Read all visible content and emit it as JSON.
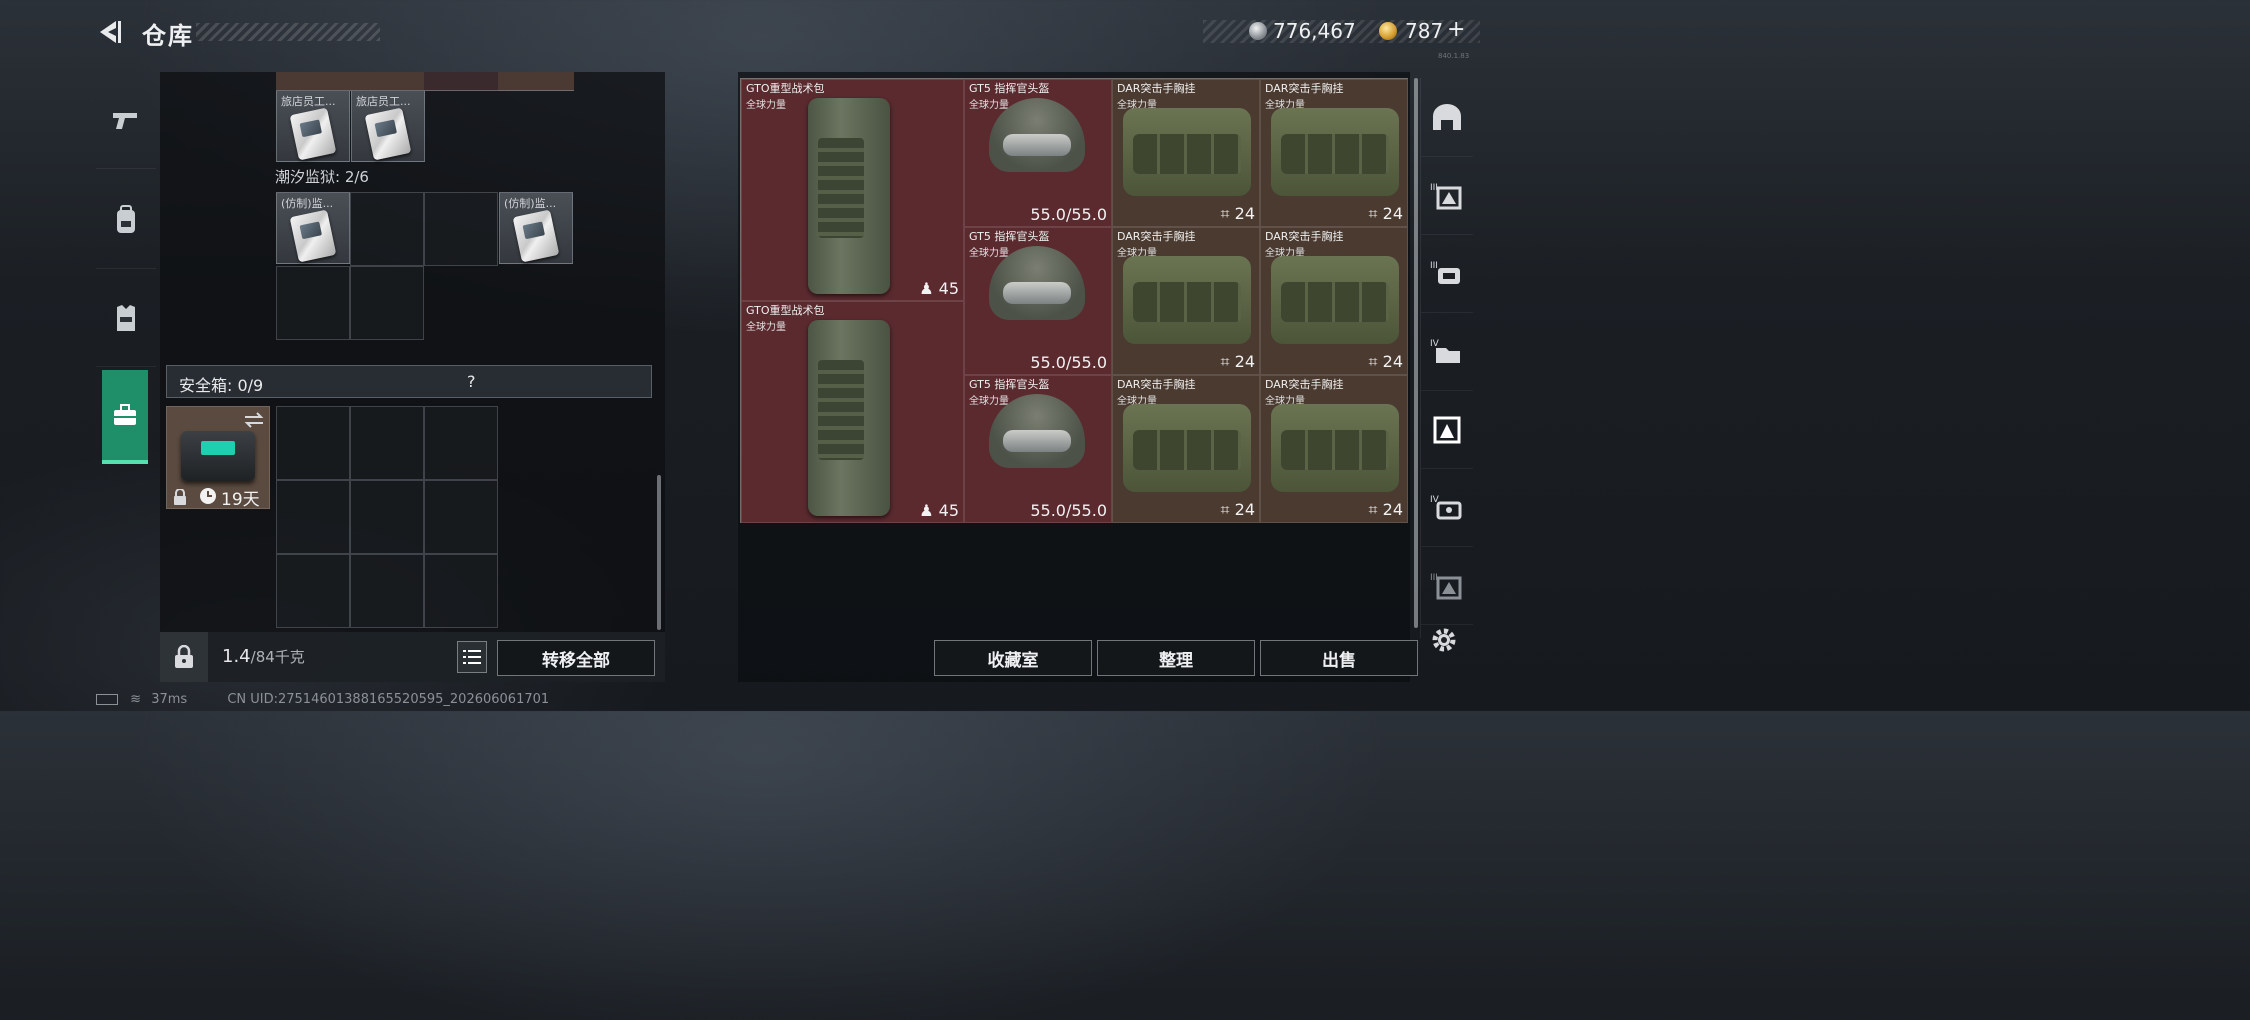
{
  "header": {
    "title": "仓库",
    "currency_silver": "776,467",
    "currency_gold": "787",
    "gold_plus": "+",
    "version": "840.1.83"
  },
  "left_nav": {
    "tabs": [
      "weapons-tab",
      "backpack-tab",
      "vest-tab",
      "safe-tab"
    ],
    "active": "safe-tab"
  },
  "inventory": {
    "top_items": [
      {
        "label": "旅店员工..."
      },
      {
        "label": "旅店员工..."
      }
    ],
    "section_label": "潮汐监狱: 2/6",
    "prison_items": [
      {
        "label": "(仿制)监..."
      },
      {
        "label": "(仿制)监..."
      }
    ],
    "safe": {
      "label": "安全箱: 0/9",
      "help": "?",
      "timer": "19天"
    },
    "weight_current": "1.4",
    "weight_max": "/84千克",
    "transfer_all": "转移全部"
  },
  "stash": {
    "items": [
      {
        "name": "GTO重型战术包",
        "sub": "全球力量",
        "value": "45",
        "color": "red"
      },
      {
        "name": "GT5 指挥官头盔",
        "sub": "全球力量",
        "value": "55.0/55.0",
        "color": "red"
      },
      {
        "name": "DAR突击手胸挂",
        "sub": "全球力量",
        "value": "24",
        "color": "brown"
      },
      {
        "name": "DAR突击手胸挂",
        "sub": "全球力量",
        "value": "24",
        "color": "brown"
      },
      {
        "name": "GT5 指挥官头盔",
        "sub": "全球力量",
        "value": "55.0/55.0",
        "color": "red"
      },
      {
        "name": "DAR突击手胸挂",
        "sub": "全球力量",
        "value": "24",
        "color": "brown"
      },
      {
        "name": "DAR突击手胸挂",
        "sub": "全球力量",
        "value": "24",
        "color": "brown"
      },
      {
        "name": "GTO重型战术包",
        "sub": "全球力量",
        "value": "45",
        "color": "red"
      },
      {
        "name": "GT5 指挥官头盔",
        "sub": "全球力量",
        "value": "55.0/55.0",
        "color": "red"
      },
      {
        "name": "DAR突击手胸挂",
        "sub": "全球力量",
        "value": "24",
        "color": "brown"
      },
      {
        "name": "DAR突击手胸挂",
        "sub": "全球力量",
        "value": "24",
        "color": "brown"
      }
    ],
    "buttons": {
      "collection": "收藏室",
      "sort": "整理",
      "sell": "出售"
    }
  },
  "right_nav": {
    "tabs": [
      "helmet-tab",
      "lvl3-vest-tab",
      "lvl3-backpack-tab",
      "lvl4-folder-tab",
      "vest-tab-active",
      "lvl4-vest-tab",
      "vest-tab"
    ]
  },
  "status": {
    "ping": "37ms",
    "uid": "CN UID:27514601388165520595_202606061701"
  },
  "colors": {
    "accent": "#1f8f6a",
    "red_item": "#5a2a2f",
    "brown_item": "#4a3a30"
  }
}
